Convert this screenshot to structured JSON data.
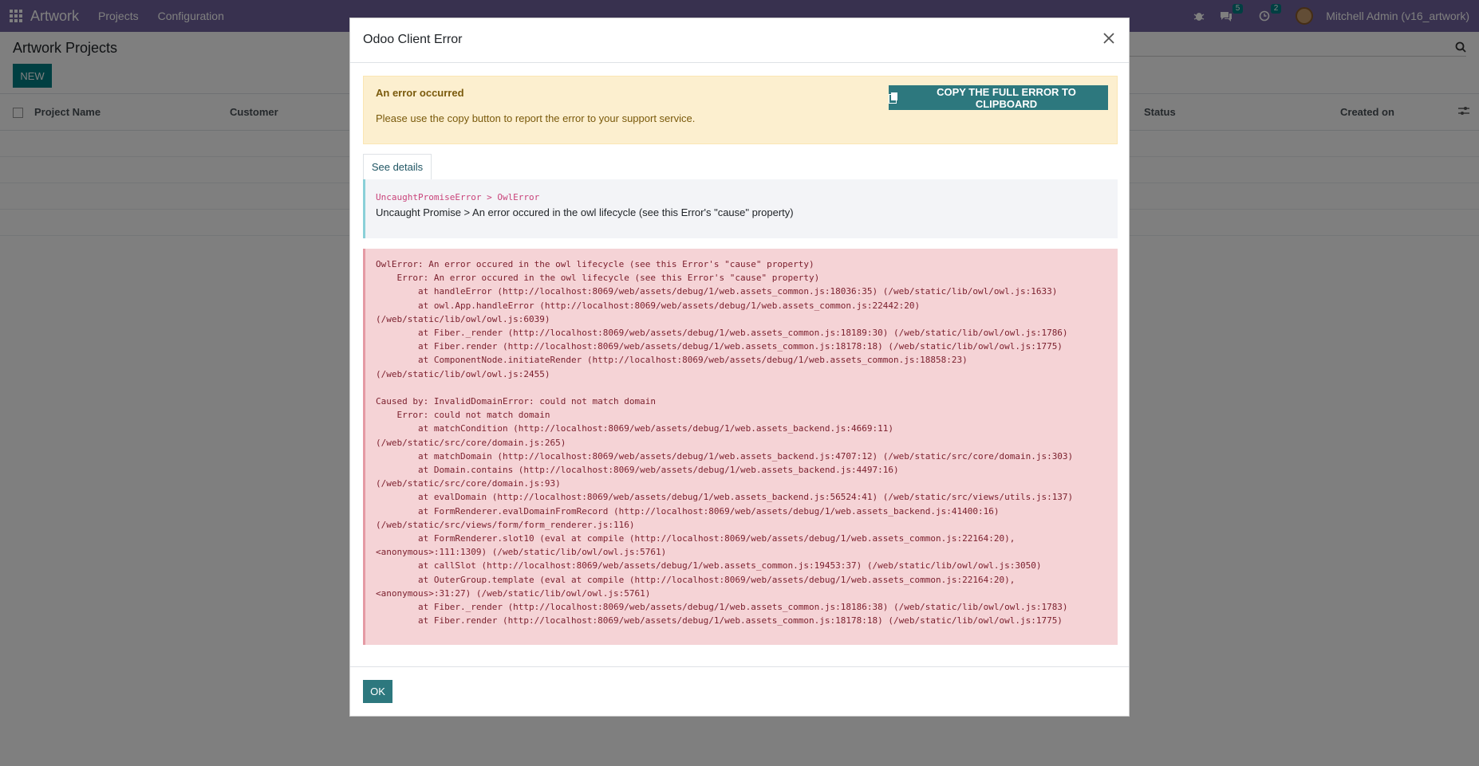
{
  "navbar": {
    "app_name": "Artwork",
    "menu": [
      "Projects",
      "Configuration"
    ],
    "discuss_count": "5",
    "activity_count": "2",
    "user_name": "Mitchell Admin (v16_artwork)"
  },
  "control_panel": {
    "title": "Artwork Projects",
    "new_label": "NEW"
  },
  "list": {
    "columns": [
      "Project Name",
      "Customer",
      "Status",
      "Created on"
    ]
  },
  "modal": {
    "title": "Odoo Client Error",
    "alert_title": "An error occurred",
    "alert_text": "Please use the copy button to report the error to your support service.",
    "copy_label": "COPY THE FULL ERROR TO CLIPBOARD",
    "see_details_label": "See details",
    "error_chain": "UncaughtPromiseError > OwlError",
    "error_message": "Uncaught Promise > An error occured in the owl lifecycle (see this Error's \"cause\" property)",
    "traceback": "OwlError: An error occured in the owl lifecycle (see this Error's \"cause\" property)\n    Error: An error occured in the owl lifecycle (see this Error's \"cause\" property)\n        at handleError (http://localhost:8069/web/assets/debug/1/web.assets_common.js:18036:35) (/web/static/lib/owl/owl.js:1633)\n        at owl.App.handleError (http://localhost:8069/web/assets/debug/1/web.assets_common.js:22442:20)\n(/web/static/lib/owl/owl.js:6039)\n        at Fiber._render (http://localhost:8069/web/assets/debug/1/web.assets_common.js:18189:30) (/web/static/lib/owl/owl.js:1786)\n        at Fiber.render (http://localhost:8069/web/assets/debug/1/web.assets_common.js:18178:18) (/web/static/lib/owl/owl.js:1775)\n        at ComponentNode.initiateRender (http://localhost:8069/web/assets/debug/1/web.assets_common.js:18858:23)\n(/web/static/lib/owl/owl.js:2455)\n\nCaused by: InvalidDomainError: could not match domain\n    Error: could not match domain\n        at matchCondition (http://localhost:8069/web/assets/debug/1/web.assets_backend.js:4669:11)\n(/web/static/src/core/domain.js:265)\n        at matchDomain (http://localhost:8069/web/assets/debug/1/web.assets_backend.js:4707:12) (/web/static/src/core/domain.js:303)\n        at Domain.contains (http://localhost:8069/web/assets/debug/1/web.assets_backend.js:4497:16)\n(/web/static/src/core/domain.js:93)\n        at evalDomain (http://localhost:8069/web/assets/debug/1/web.assets_backend.js:56524:41) (/web/static/src/views/utils.js:137)\n        at FormRenderer.evalDomainFromRecord (http://localhost:8069/web/assets/debug/1/web.assets_backend.js:41400:16)\n(/web/static/src/views/form/form_renderer.js:116)\n        at FormRenderer.slot10 (eval at compile (http://localhost:8069/web/assets/debug/1/web.assets_common.js:22164:20),\n<anonymous>:111:1309) (/web/static/lib/owl/owl.js:5761)\n        at callSlot (http://localhost:8069/web/assets/debug/1/web.assets_common.js:19453:37) (/web/static/lib/owl/owl.js:3050)\n        at OuterGroup.template (eval at compile (http://localhost:8069/web/assets/debug/1/web.assets_common.js:22164:20),\n<anonymous>:31:27) (/web/static/lib/owl/owl.js:5761)\n        at Fiber._render (http://localhost:8069/web/assets/debug/1/web.assets_common.js:18186:38) (/web/static/lib/owl/owl.js:1783)\n        at Fiber.render (http://localhost:8069/web/assets/debug/1/web.assets_common.js:18178:18) (/web/static/lib/owl/owl.js:1775)",
    "ok_label": "OK"
  }
}
